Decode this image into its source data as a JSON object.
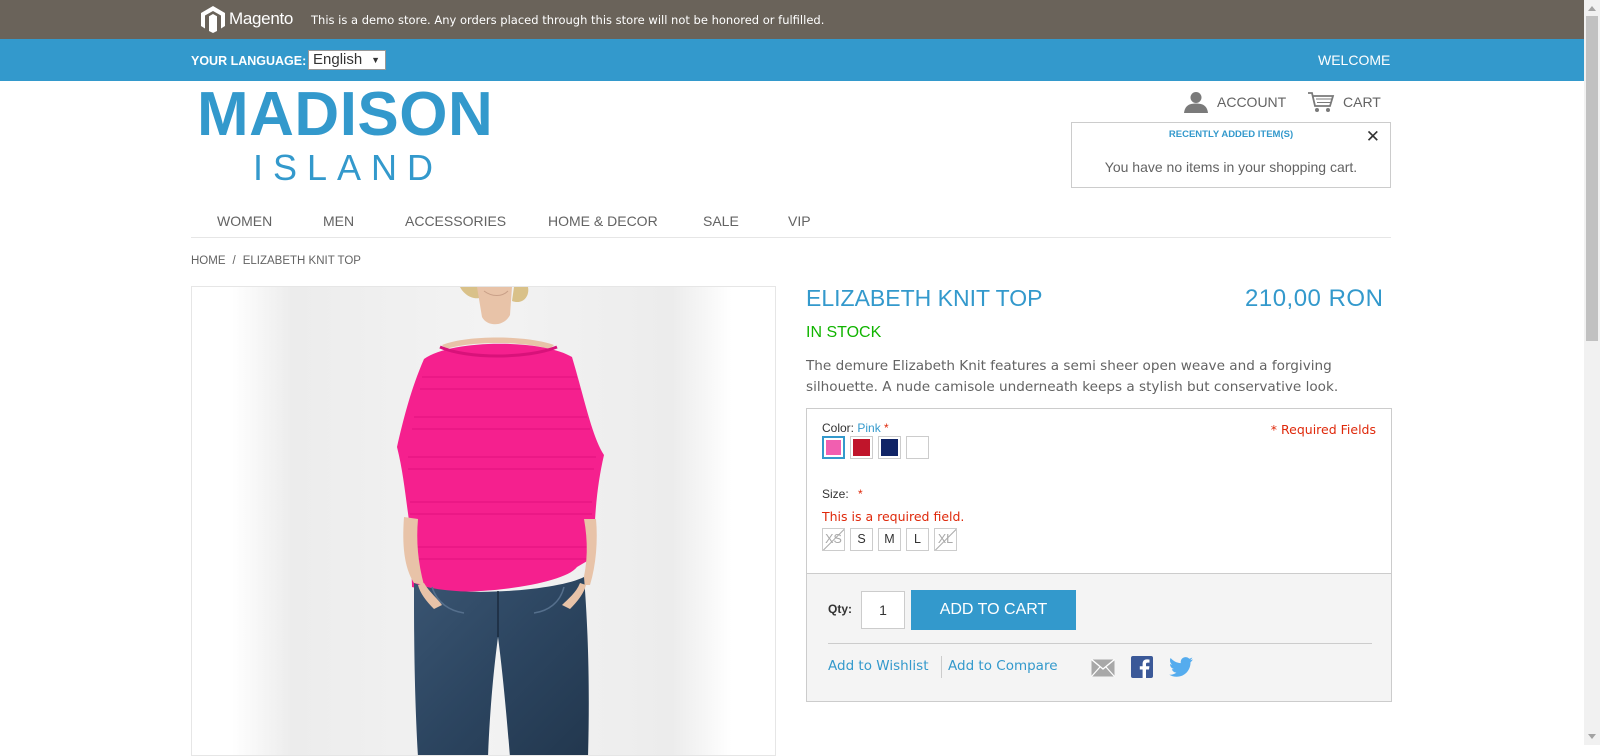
{
  "demo_bar": {
    "logo_text": "Magento",
    "notice": "This is a demo store. Any orders placed through this store will not be honored or fulfilled."
  },
  "header": {
    "language_label": "YOUR LANGUAGE:",
    "language_value": "English",
    "welcome": "WELCOME",
    "logo_main": "MADISON",
    "logo_sub": "ISLAND",
    "account_label": "ACCOUNT",
    "cart_label": "CART"
  },
  "mini_cart": {
    "title": "RECENTLY ADDED ITEM(S)",
    "close": "✕",
    "message": "You have no items in your shopping cart."
  },
  "nav": {
    "items": [
      "WOMEN",
      "MEN",
      "ACCESSORIES",
      "HOME & DECOR",
      "SALE",
      "VIP"
    ]
  },
  "breadcrumb": {
    "home": "HOME",
    "separator": "/",
    "current": "ELIZABETH KNIT TOP"
  },
  "product": {
    "name": "ELIZABETH KNIT TOP",
    "price": "210,00 RON",
    "stock": "IN STOCK",
    "description": "The demure Elizabeth Knit features a semi sheer open weave and a forgiving silhouette. A nude camisole underneath keeps a stylish but conservative look."
  },
  "options": {
    "color_label": "Color:",
    "color_value": "Pink",
    "required_star": "*",
    "required_fields": "* Required Fields",
    "colors": [
      {
        "name": "Pink",
        "hex": "#f15fb0"
      },
      {
        "name": "Red",
        "hex": "#c0152b"
      },
      {
        "name": "Navy",
        "hex": "#102466"
      },
      {
        "name": "White",
        "hex": "#ffffff"
      }
    ],
    "size_label": "Size:",
    "size_error": "This is a required field.",
    "sizes": [
      {
        "label": "XS",
        "available": false
      },
      {
        "label": "S",
        "available": true
      },
      {
        "label": "M",
        "available": true
      },
      {
        "label": "L",
        "available": true
      },
      {
        "label": "XL",
        "available": false
      }
    ]
  },
  "add_to_cart": {
    "qty_label": "Qty:",
    "qty_value": "1",
    "button_label": "ADD TO CART",
    "wishlist": "Add to Wishlist",
    "compare": "Add to Compare"
  },
  "colors": {
    "accent": "#3399cc",
    "demo_bar": "#6a635a",
    "in_stock": "#11b400",
    "error": "#df280a",
    "product_pink": "#f5208e"
  },
  "icons": [
    "magento-logo-icon",
    "user-icon",
    "cart-icon",
    "close-icon",
    "email-icon",
    "facebook-icon",
    "twitter-icon"
  ]
}
